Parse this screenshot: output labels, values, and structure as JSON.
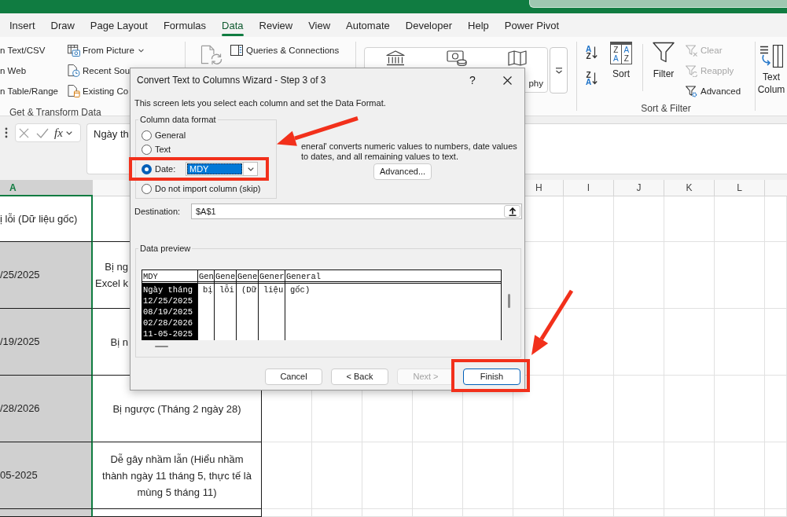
{
  "ribbon_tabs": [
    {
      "label": "Insert",
      "selected": false
    },
    {
      "label": "Draw",
      "selected": false
    },
    {
      "label": "Page Layout",
      "selected": false
    },
    {
      "label": "Formulas",
      "selected": false
    },
    {
      "label": "Data",
      "selected": true
    },
    {
      "label": "Review",
      "selected": false
    },
    {
      "label": "View",
      "selected": false
    },
    {
      "label": "Automate",
      "selected": false
    },
    {
      "label": "Developer",
      "selected": false
    },
    {
      "label": "Help",
      "selected": false
    },
    {
      "label": "Power Pivot",
      "selected": false
    }
  ],
  "ribbon": {
    "get_transform_data": {
      "column_1": [
        "n Text/CSV",
        "n Web",
        "n Table/Range"
      ],
      "column_2": [
        {
          "kind": "picture",
          "label": "From Picture",
          "dropdown": true
        },
        {
          "kind": "recent",
          "label": "Recent Sou",
          "dropdown": false
        },
        {
          "kind": "connections",
          "label": "Existing Co",
          "dropdown": false
        }
      ],
      "label": "Get & Transform Data"
    },
    "queries": {
      "label": "Queries & Connections"
    },
    "data_types": {
      "gallery_label": "phy"
    },
    "sort_filter": {
      "sort_ascending": [
        "A",
        "Z"
      ],
      "sort_descending": [
        "Z",
        "A"
      ],
      "sort": {
        "letters": [
          [
            "Z",
            "A"
          ],
          [
            "A",
            "Z"
          ]
        ],
        "label": "Sort"
      },
      "filter": {
        "label": "Filter"
      },
      "actions": [
        {
          "kind": "clear",
          "label": "Clear",
          "disabled": true
        },
        {
          "kind": "reapply",
          "label": "Reapply",
          "disabled": true
        },
        {
          "kind": "advanced",
          "label": "Advanced",
          "disabled": false
        }
      ],
      "label": "Sort & Filter"
    },
    "text_to_columns": {
      "lines": [
        "Text",
        "Colum"
      ]
    }
  },
  "formula_bar": {
    "function_button": "fx",
    "value": "Ngày th"
  },
  "sheet": {
    "columns": [
      {
        "label": "A",
        "selected": true
      },
      {
        "label": "H",
        "selected": false
      },
      {
        "label": "I",
        "selected": false
      },
      {
        "label": "J",
        "selected": false
      },
      {
        "label": "K",
        "selected": false
      },
      {
        "label": "L",
        "selected": false
      }
    ],
    "rows": [
      {
        "column_a": {
          "lines": [
            "ị lỗi (Dữ liệu gốc)"
          ],
          "active": true
        }
      },
      {
        "column_a": {
          "lines": [
            "/25/2025"
          ],
          "active": false
        },
        "column_b": {
          "lines": [
            "Bị ng",
            "Excel k"
          ]
        }
      },
      {
        "column_a": {
          "lines": [
            "/19/2025"
          ],
          "active": false
        },
        "column_b": {
          "lines": [
            "Bị n"
          ]
        }
      },
      {
        "column_a": {
          "lines": [
            "/28/2026"
          ],
          "active": false
        },
        "column_b": {
          "lines": [
            "Bị ngược (Tháng 2 ngày 28)"
          ]
        }
      },
      {
        "column_a": {
          "lines": [
            "05-2025"
          ],
          "active": false
        },
        "column_b": {
          "lines": [
            "Dễ gây nhầm lẫn (Hiểu nhầm",
            "thành ngày 11 tháng 5, thực tế là",
            "mùng 5 tháng 11)"
          ]
        }
      },
      {
        "column_a": {
          "active": false
        }
      }
    ]
  },
  "dialog": {
    "title": "Convert Text to Columns Wizard - Step 3 of 3",
    "help": "?",
    "intro": "This screen lets you select each column and set the Data Format.",
    "column_data_format": {
      "label": "Column data format",
      "options": [
        {
          "kind": "plain",
          "label": "General",
          "selected": false,
          "highlighted": false
        },
        {
          "kind": "plain",
          "label": "Text",
          "selected": false,
          "highlighted": false
        },
        {
          "kind": "dropdown",
          "label": "Date:",
          "value": "MDY",
          "value_focused": true,
          "selected": true,
          "highlighted": true
        },
        {
          "kind": "plain",
          "label": "Do not import column (skip)",
          "selected": false,
          "highlighted": false
        }
      ]
    },
    "description": "eneral' converts numeric values to numbers, date values to dates, and all remaining values to text.",
    "advanced_button": "Advanced...",
    "destination": {
      "label": "Destination:",
      "value": "$A$1"
    },
    "data_preview": {
      "label": "Data preview",
      "columns": [
        {
          "header": "MDY",
          "selected": true,
          "cells": [
            "Ngày tháng",
            "12/25/2025",
            "08/19/2025",
            "02/28/2026",
            "11-05-2025"
          ]
        },
        {
          "header": "Gen",
          "selected": false,
          "cells": [
            "bị"
          ]
        },
        {
          "header": "Gene",
          "selected": false,
          "cells": [
            "lỗi"
          ]
        },
        {
          "header": "Gene",
          "selected": false,
          "cells": [
            "(Dữ"
          ]
        },
        {
          "header": "Gener",
          "selected": false,
          "cells": [
            "liệu"
          ]
        },
        {
          "header": "General",
          "selected": false,
          "cells": [
            "gốc)"
          ]
        }
      ]
    },
    "buttons": [
      {
        "label": "Cancel",
        "disabled": false,
        "default": false,
        "highlighted": false
      },
      {
        "label": "< Back",
        "disabled": false,
        "default": false,
        "highlighted": false
      },
      {
        "label": "Next >",
        "disabled": true,
        "default": false,
        "highlighted": false
      },
      {
        "label": "Finish",
        "disabled": false,
        "default": true,
        "highlighted": true
      }
    ]
  }
}
